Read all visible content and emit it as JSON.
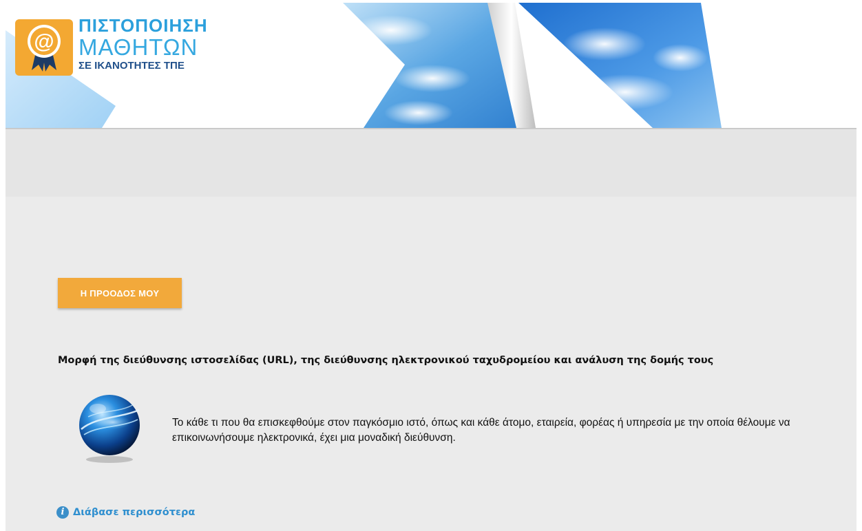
{
  "header": {
    "logo": {
      "line1": "ΠΙΣΤΟΠΟΙΗΣΗ",
      "line2": "ΜΑΘΗΤΩΝ",
      "line3": "ΣΕ ΙΚΑΝΟΤΗΤΕΣ ΤΠΕ",
      "badge_icon": "at-sign-ribbon-icon"
    },
    "colors": {
      "badge": "#f3a832",
      "title_blue": "#2ca0dc",
      "subtitle_navy": "#1f4f8a"
    }
  },
  "main": {
    "progress_button_label": "Η ΠΡΟΟΔΟΣ ΜΟΥ",
    "heading": "Μορφή της διεύθυνσης ιστοσελίδας (URL), της διεύθυνσης ηλεκτρονικού ταχυδρομείου και ανάλυση της δομής τους",
    "globe_icon": "globe-icon",
    "paragraph": "Το κάθε τι που θα επισκεφθούμε στον παγκόσμιο ιστό, όπως και κάθε άτομο, εταιρεία, φορέας ή υπηρεσία με την οποία θέλουμε να επικοινωνήσουμε ηλεκτρονικά, έχει μια μοναδική διεύθυνση.",
    "read_more": {
      "icon": "info-icon",
      "label": "Διάβασε περισσότερα"
    },
    "colors": {
      "button": "#f2a93b",
      "link": "#2f8fcf",
      "background": "#ebebeb"
    }
  }
}
